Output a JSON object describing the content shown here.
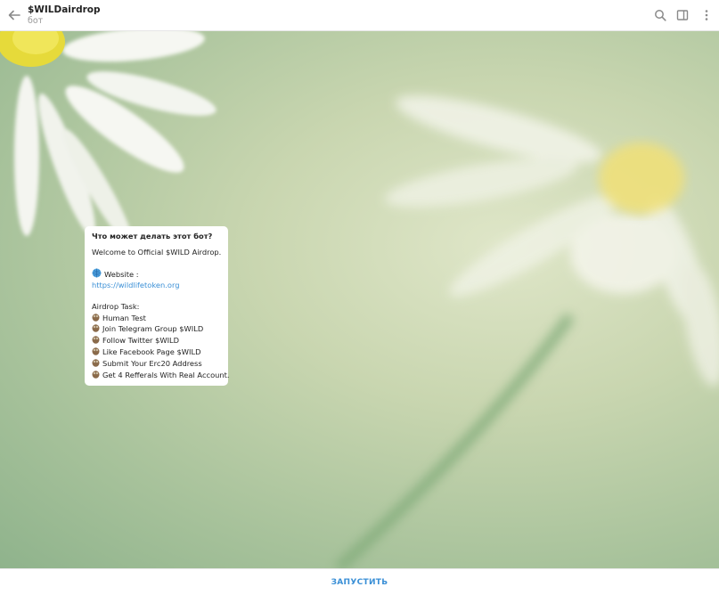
{
  "header": {
    "title": "$WILDairdrop",
    "subtitle": "бот"
  },
  "message": {
    "heading": "Что может делать этот бот?",
    "welcome": "Welcome to Official $WILD Airdrop.",
    "website_label": "Website :",
    "website_url": "https://wildlifetoken.org",
    "tasks_label": "Airdrop Task:",
    "tasks": [
      "Human Test",
      "Join Telegram Group $WILD",
      "Follow Twitter $WILD",
      "Like Facebook Page $WILD",
      "Submit Your Erc20 Address",
      "Get 4 Refferals With Real Account."
    ],
    "globe_icon": "globe-emoji-icon",
    "task_icon": "owl-emoji-icon"
  },
  "footer": {
    "start_label": "ЗАПУСТИТЬ"
  },
  "colors": {
    "accent": "#3a8fd6"
  }
}
